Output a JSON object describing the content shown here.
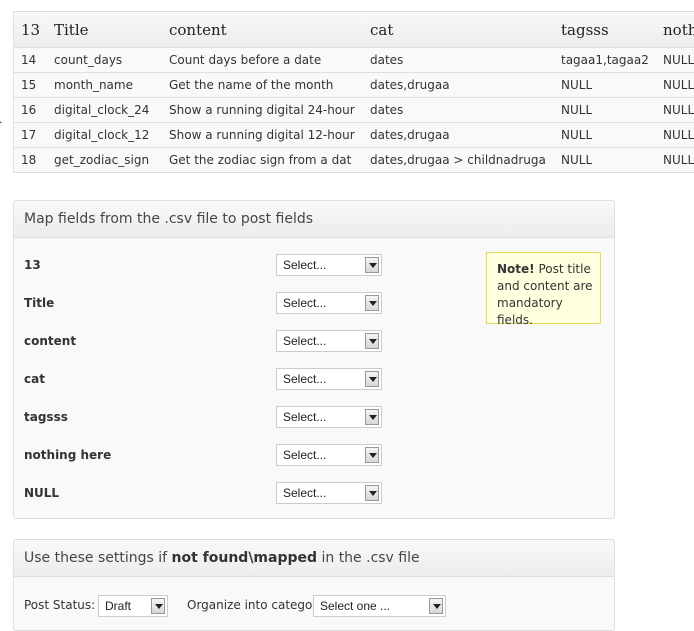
{
  "preview_table": {
    "headers": [
      "13",
      "Title",
      "content",
      "cat",
      "tagsss",
      "noth"
    ],
    "rows": [
      [
        "14",
        "count_days",
        "Count days before a date",
        "dates",
        "tagaa1,tagaa2",
        "NULL"
      ],
      [
        "15",
        "month_name",
        "Get the name of the month",
        "dates,drugaa",
        "NULL",
        "NULL"
      ],
      [
        "16",
        "digital_clock_24",
        "Show a running digital 24-hour",
        "dates",
        "NULL",
        "NULL"
      ],
      [
        "17",
        "digital_clock_12",
        "Show a running digital 12-hour",
        "dates,drugaa",
        "NULL",
        "NULL"
      ],
      [
        "18",
        "get_zodiac_sign",
        "Get the zodiac sign from a dat",
        "dates,drugaa > childnadruga",
        "NULL",
        "NULL"
      ]
    ]
  },
  "map_fields": {
    "title": "Map fields from the .csv file to post fields",
    "fields": [
      {
        "label": "13",
        "select": "Select..."
      },
      {
        "label": "Title",
        "select": "Select..."
      },
      {
        "label": "content",
        "select": "Select..."
      },
      {
        "label": "cat",
        "select": "Select..."
      },
      {
        "label": "tagsss",
        "select": "Select..."
      },
      {
        "label": "nothing here",
        "select": "Select..."
      },
      {
        "label": "NULL",
        "select": "Select..."
      }
    ],
    "note": {
      "strong": "Note!",
      "text": " Post title and content are mandatory fields."
    }
  },
  "settings": {
    "title_pre": "Use these settings if ",
    "title_bold": "not found\\mapped",
    "title_post": " in the .csv file",
    "post_status_label": "Post Status:",
    "post_status_value": "Draft",
    "category_label": "Organize into category",
    "category_value": "Select one ..."
  }
}
